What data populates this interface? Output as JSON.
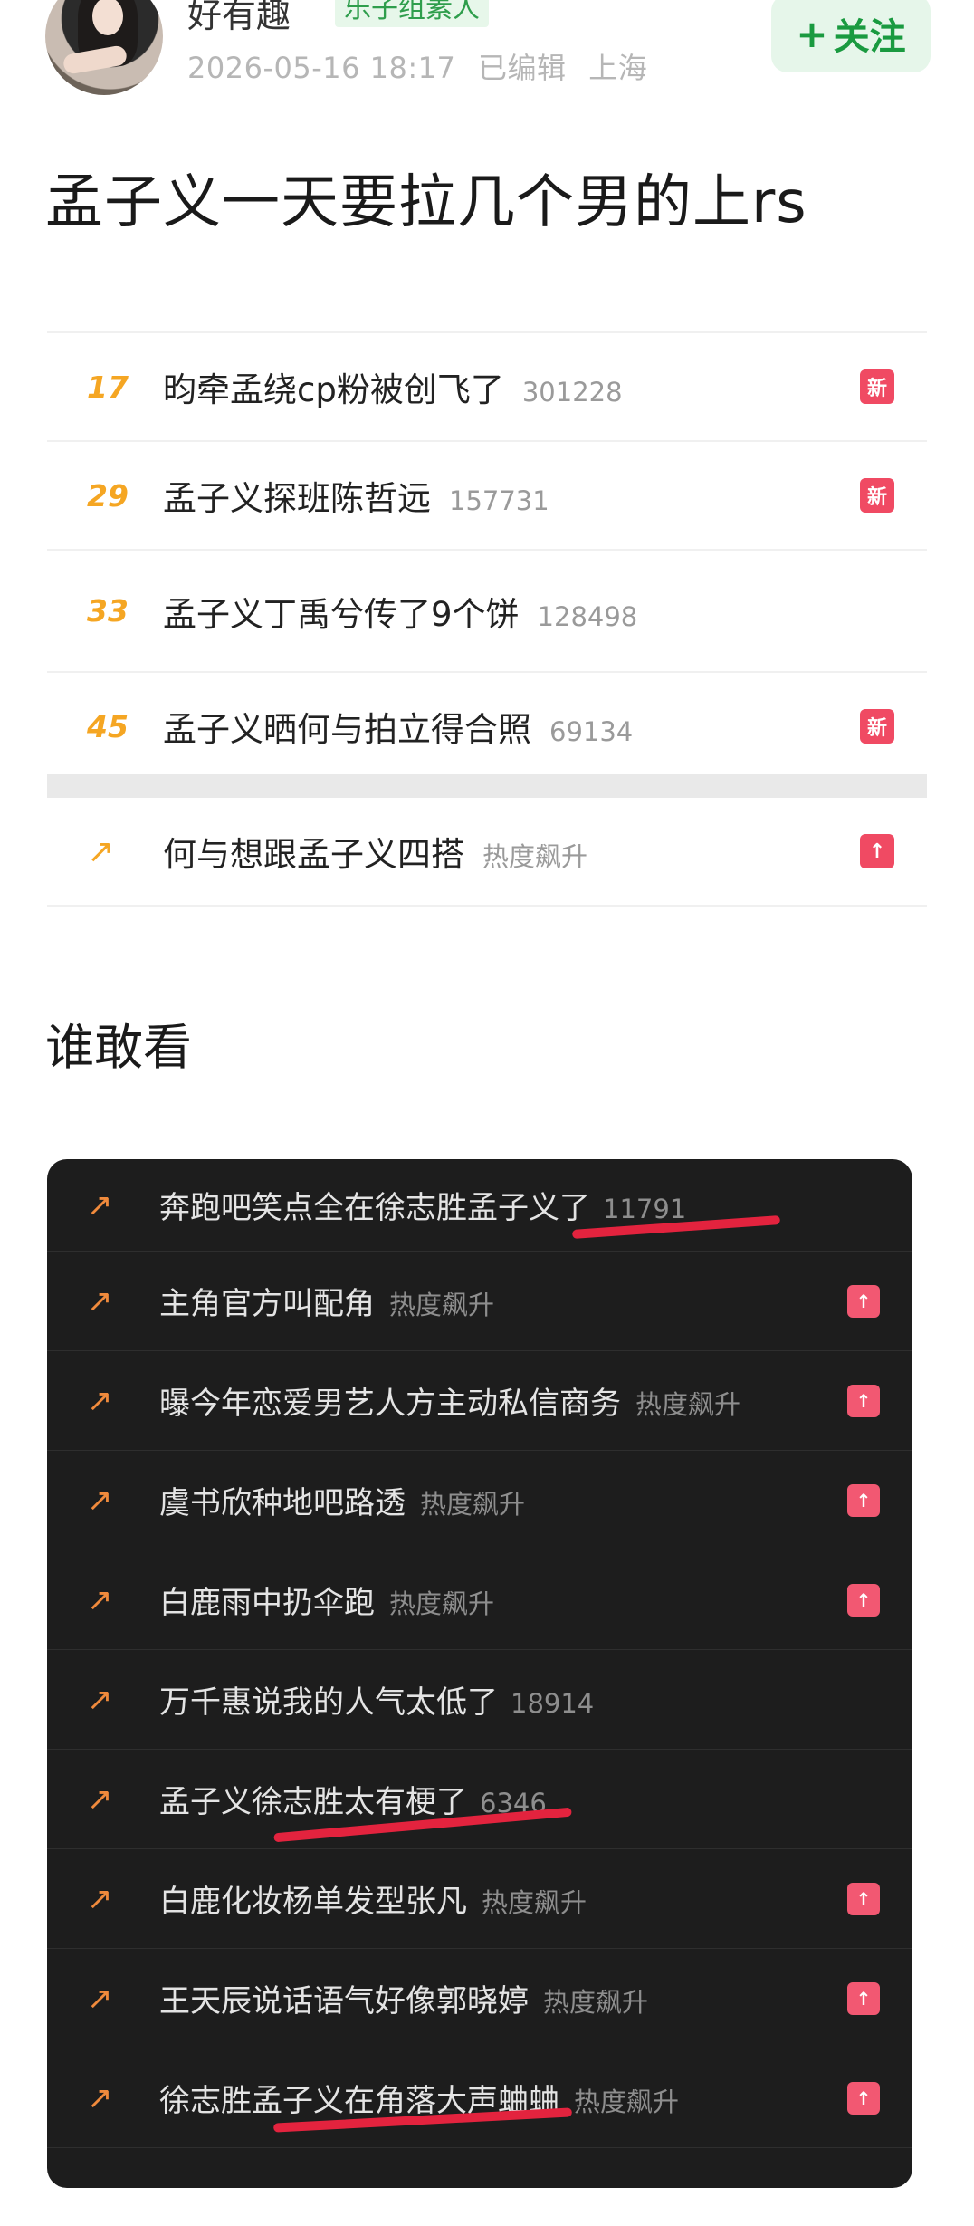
{
  "header": {
    "username": "好有趣",
    "badge": "乐子组素人",
    "date": "2026-05-16 18:17",
    "edited": "已编辑",
    "location": "上海",
    "follow_label": "关注",
    "follow_icon": "plus-icon"
  },
  "post": {
    "title": "孟子义一天要拉几个男的上rs"
  },
  "top_list": [
    {
      "rank": "17",
      "title": "昀牵孟绕cp粉被创飞了",
      "count": "301228",
      "tag": "新"
    },
    {
      "rank": "29",
      "title": "孟子义探班陈哲远",
      "count": "157731",
      "tag": "新"
    },
    {
      "rank": "33",
      "title": "孟子义丁禹兮传了9个饼",
      "count": "128498",
      "tag": ""
    },
    {
      "rank": "45",
      "title": "孟子义晒何与拍立得合照",
      "count": "69134",
      "tag": "新"
    },
    {
      "rank": "↗",
      "title": "何与想跟孟子义四搭",
      "count": "热度飙升",
      "tag": "↑"
    }
  ],
  "section": {
    "title": "谁敢看"
  },
  "dark_list": [
    {
      "title": "奔跑吧笑点全在徐志胜孟子义了",
      "count": "11791",
      "tag": ""
    },
    {
      "title": "主角官方叫配角",
      "count": "热度飙升",
      "tag": "↑"
    },
    {
      "title": "曝今年恋爱男艺人方主动私信商务",
      "count": "热度飙升",
      "tag": "↑"
    },
    {
      "title": "虞书欣种地吧路透",
      "count": "热度飙升",
      "tag": "↑"
    },
    {
      "title": "白鹿雨中扔伞跑",
      "count": "热度飙升",
      "tag": "↑"
    },
    {
      "title": "万千惠说我的人气太低了",
      "count": "18914",
      "tag": ""
    },
    {
      "title": "孟子义徐志胜太有梗了",
      "count": "6346",
      "tag": ""
    },
    {
      "title": "白鹿化妆杨单发型张凡",
      "count": "热度飙升",
      "tag": "↑"
    },
    {
      "title": "王天辰说话语气好像郭晓婷",
      "count": "热度飙升",
      "tag": "↑"
    },
    {
      "title": "徐志胜孟子义在角落大声蛐蛐",
      "count": "热度飙升",
      "tag": "↑"
    }
  ],
  "colors": {
    "rank": "#f5a623",
    "tag_new": "#f04a63",
    "follow_text": "#1a9a40",
    "dark_bg": "#1d1d1d",
    "highlight_underline": "#e3233e"
  }
}
